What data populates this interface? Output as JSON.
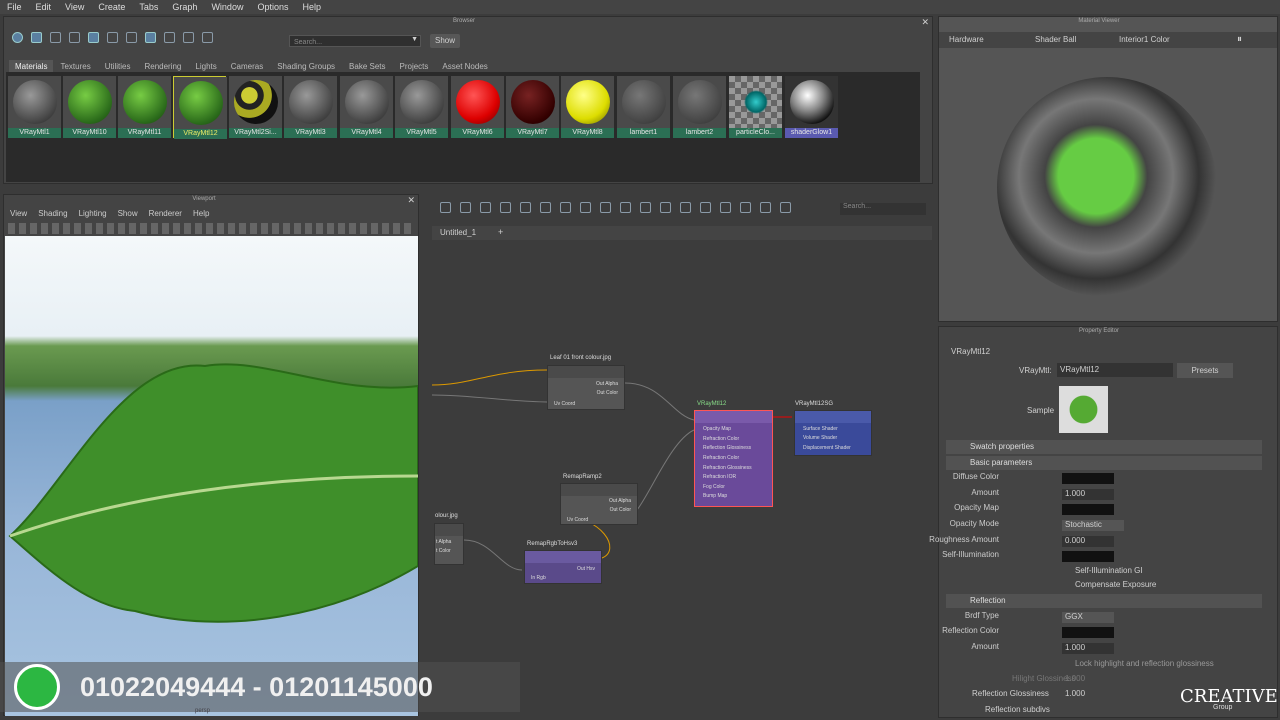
{
  "menu": [
    "File",
    "Edit",
    "View",
    "Create",
    "Tabs",
    "Graph",
    "Window",
    "Options",
    "Help"
  ],
  "browser": {
    "title": "Browser",
    "search_placeholder": "Search...",
    "show": "Show",
    "tabs": [
      "Materials",
      "Textures",
      "Utilities",
      "Rendering",
      "Lights",
      "Cameras",
      "Shading Groups",
      "Bake Sets",
      "Projects",
      "Asset Nodes"
    ],
    "materials": [
      "VRayMtl1",
      "VRayMtl10",
      "VRayMtl11",
      "VRayMtl12",
      "VRayMtl2Si...",
      "VRayMtl3",
      "VRayMtl4",
      "VRayMtl5",
      "VRayMtl6",
      "VRayMtl7",
      "VRayMtl8",
      "lambert1",
      "lambert2",
      "particleClo...",
      "shaderGlow1"
    ]
  },
  "viewport": {
    "title": "Viewport",
    "menus": [
      "View",
      "Shading",
      "Lighting",
      "Show",
      "Renderer",
      "Help"
    ],
    "persp": "persp"
  },
  "graph": {
    "search_placeholder": "Search...",
    "tab": "Untitled_1",
    "add": "+",
    "n1": {
      "title": "Leaf 01 front colour.jpg",
      "p1": "Out Alpha",
      "p2": "Out Color",
      "p3": "Uv Coord"
    },
    "n2": {
      "title": "RemapRamp2",
      "p1": "Out Alpha",
      "p2": "Out Color",
      "p3": "Uv Coord"
    },
    "n3": {
      "title": "olour.jpg",
      "p1": "t Alpha",
      "p2": "t Color"
    },
    "n4": {
      "title": "RemapRgbToHsv3",
      "p1": "Out Hsv",
      "p2": "In Rgb"
    },
    "n5": {
      "title": "VRayMtl12",
      "ports": [
        "Opacity Map",
        "Refraction Color",
        "Reflection Glossiness",
        "Refraction Color",
        "Refraction Glossiness",
        "Refraction IOR",
        "Fog Color",
        "Bump Map"
      ]
    },
    "n6": {
      "title": "VRayMtl12SG",
      "ports": [
        "Surface Shader",
        "Volume Shader",
        "Displacement Shader"
      ]
    }
  },
  "matviewer": {
    "title": "Material Viewer",
    "renderer": "Hardware",
    "shape": "Shader Ball",
    "env": "Interior1 Color"
  },
  "props": {
    "title": "Property Editor",
    "node": "VRayMtl12",
    "type_label": "VRayMtl:",
    "name_value": "VRayMtl12",
    "presets": "Presets",
    "sample": "Sample",
    "swatch": "Swatch properties",
    "basic": "Basic parameters",
    "rows": [
      {
        "k": "Diffuse Color",
        "v": ""
      },
      {
        "k": "Amount",
        "v": "1.000"
      },
      {
        "k": "Opacity Map",
        "v": ""
      },
      {
        "k": "Opacity Mode",
        "v": "Stochastic"
      },
      {
        "k": "Roughness Amount",
        "v": "0.000"
      },
      {
        "k": "Self-Illumination",
        "v": ""
      }
    ],
    "chk1": "Self-Illumination GI",
    "chk2": "Compensate Exposure",
    "reflection": "Reflection",
    "rrows": [
      {
        "k": "Brdf Type",
        "v": "GGX"
      },
      {
        "k": "Reflection Color",
        "v": ""
      },
      {
        "k": "Amount",
        "v": "1.000"
      }
    ],
    "lock": "Lock highlight and reflection glossiness",
    "hg": "Hilight Glossiness",
    "hg_v": "1.000",
    "rg": "Reflection Glossiness",
    "rg_v": "1.000",
    "rsub": "Reflection subdivs"
  },
  "overlay": {
    "phone": "01022049444 - 01201145000",
    "logo": "CREATIVE",
    "logo_sub": "Group"
  }
}
